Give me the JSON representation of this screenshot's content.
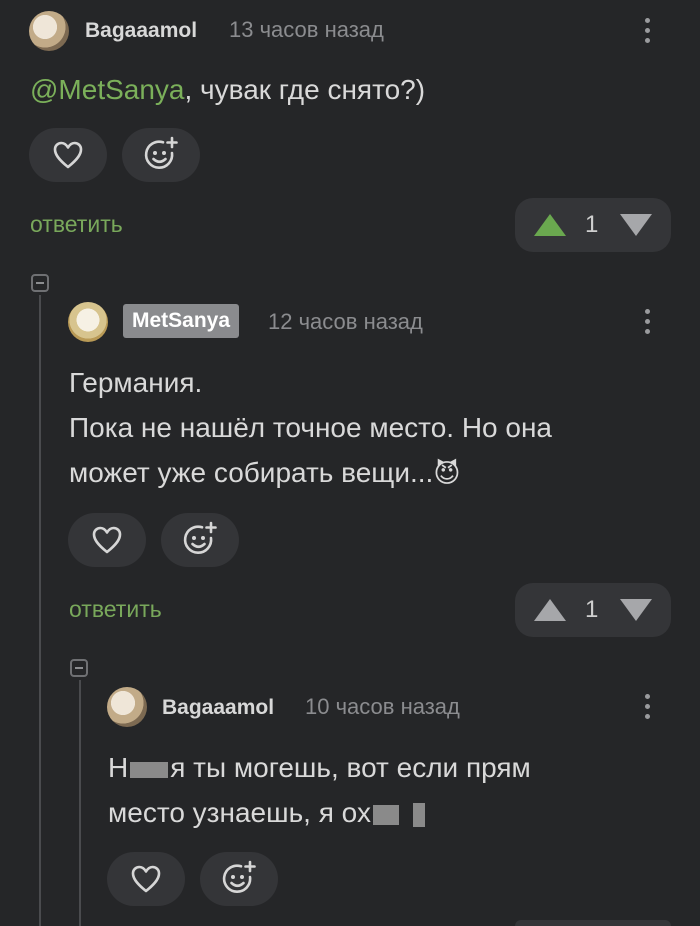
{
  "comments": [
    {
      "username": "Bagaaamol",
      "time": "13 часов назад",
      "mention": "@MetSanya",
      "text": ", чувак где снято?)",
      "reply_label": "ответить",
      "rating": "1"
    },
    {
      "username": "MetSanya",
      "time": "12 часов назад",
      "text_lines": [
        "Германия.",
        "Пока не нашёл точное место. Но она",
        "может уже собирать вещи..."
      ],
      "emoji": "😈",
      "reply_label": "ответить",
      "rating": "1"
    },
    {
      "username": "Bagaaamol",
      "time": "10 часов назад",
      "line1_start": "Н",
      "line1_end": "я ты могешь, вот если прям",
      "line2_start": "место узнаешь, я ох"
    }
  ],
  "icons": {
    "like": "heart-icon",
    "react": "emoji-add-icon",
    "more": "more-vertical-icon",
    "upvote": "upvote-icon",
    "downvote": "downvote-icon",
    "collapse": "collapse-icon"
  },
  "colors": {
    "background": "#252628",
    "accent_green": "#79a85b",
    "upvote_active": "#6aa84f",
    "pill_bg": "#343538"
  }
}
